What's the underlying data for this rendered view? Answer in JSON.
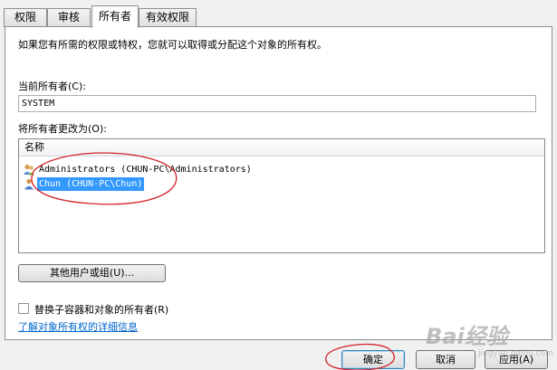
{
  "tabs": [
    {
      "label": "权限"
    },
    {
      "label": "审核"
    },
    {
      "label": "所有者"
    },
    {
      "label": "有效权限"
    }
  ],
  "active_tab": "所有者",
  "info_text": "如果您有所需的权限或特权，您就可以取得或分配这个对象的所有权。",
  "current_owner": {
    "label": "当前所有者(C):",
    "value": "SYSTEM"
  },
  "change_owner": {
    "label": "将所有者更改为(O):",
    "column_header": "名称",
    "items": [
      {
        "label": "Administrators (CHUN-PC\\Administrators)",
        "icon": "user-group-icon",
        "selected": false
      },
      {
        "label": "Chun (CHUN-PC\\Chun)",
        "icon": "user-icon",
        "selected": true
      }
    ]
  },
  "other_users_button": "其他用户或组(U)...",
  "replace_checkbox": {
    "label": "替换子容器和对象的所有者(R)",
    "checked": false
  },
  "learn_more_link": "了解对象所有权的详细信息",
  "buttons": {
    "ok": "确定",
    "cancel": "取消",
    "apply": "应用(A)"
  },
  "watermark": {
    "brand": "Bai经验",
    "url": "jingyan.baidu.com"
  },
  "colors": {
    "selection": "#3399ff",
    "link": "#0066cc",
    "annotation": "#d2232a"
  }
}
